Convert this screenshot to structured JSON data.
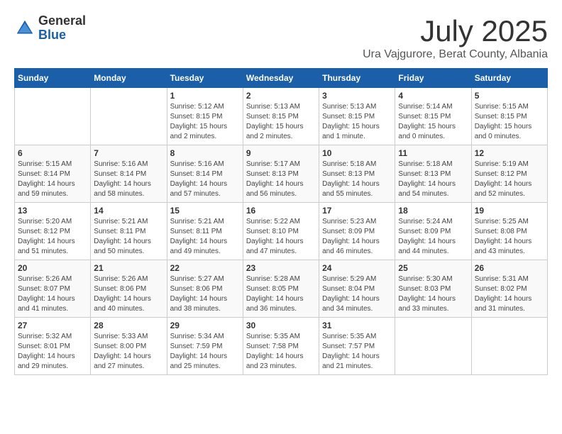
{
  "logo": {
    "general": "General",
    "blue": "Blue"
  },
  "title": {
    "month": "July 2025",
    "location": "Ura Vajgurore, Berat County, Albania"
  },
  "weekdays": [
    "Sunday",
    "Monday",
    "Tuesday",
    "Wednesday",
    "Thursday",
    "Friday",
    "Saturday"
  ],
  "weeks": [
    [
      {
        "day": "",
        "detail": ""
      },
      {
        "day": "",
        "detail": ""
      },
      {
        "day": "1",
        "detail": "Sunrise: 5:12 AM\nSunset: 8:15 PM\nDaylight: 15 hours and 2 minutes."
      },
      {
        "day": "2",
        "detail": "Sunrise: 5:13 AM\nSunset: 8:15 PM\nDaylight: 15 hours and 2 minutes."
      },
      {
        "day": "3",
        "detail": "Sunrise: 5:13 AM\nSunset: 8:15 PM\nDaylight: 15 hours and 1 minute."
      },
      {
        "day": "4",
        "detail": "Sunrise: 5:14 AM\nSunset: 8:15 PM\nDaylight: 15 hours and 0 minutes."
      },
      {
        "day": "5",
        "detail": "Sunrise: 5:15 AM\nSunset: 8:15 PM\nDaylight: 15 hours and 0 minutes."
      }
    ],
    [
      {
        "day": "6",
        "detail": "Sunrise: 5:15 AM\nSunset: 8:14 PM\nDaylight: 14 hours and 59 minutes."
      },
      {
        "day": "7",
        "detail": "Sunrise: 5:16 AM\nSunset: 8:14 PM\nDaylight: 14 hours and 58 minutes."
      },
      {
        "day": "8",
        "detail": "Sunrise: 5:16 AM\nSunset: 8:14 PM\nDaylight: 14 hours and 57 minutes."
      },
      {
        "day": "9",
        "detail": "Sunrise: 5:17 AM\nSunset: 8:13 PM\nDaylight: 14 hours and 56 minutes."
      },
      {
        "day": "10",
        "detail": "Sunrise: 5:18 AM\nSunset: 8:13 PM\nDaylight: 14 hours and 55 minutes."
      },
      {
        "day": "11",
        "detail": "Sunrise: 5:18 AM\nSunset: 8:13 PM\nDaylight: 14 hours and 54 minutes."
      },
      {
        "day": "12",
        "detail": "Sunrise: 5:19 AM\nSunset: 8:12 PM\nDaylight: 14 hours and 52 minutes."
      }
    ],
    [
      {
        "day": "13",
        "detail": "Sunrise: 5:20 AM\nSunset: 8:12 PM\nDaylight: 14 hours and 51 minutes."
      },
      {
        "day": "14",
        "detail": "Sunrise: 5:21 AM\nSunset: 8:11 PM\nDaylight: 14 hours and 50 minutes."
      },
      {
        "day": "15",
        "detail": "Sunrise: 5:21 AM\nSunset: 8:11 PM\nDaylight: 14 hours and 49 minutes."
      },
      {
        "day": "16",
        "detail": "Sunrise: 5:22 AM\nSunset: 8:10 PM\nDaylight: 14 hours and 47 minutes."
      },
      {
        "day": "17",
        "detail": "Sunrise: 5:23 AM\nSunset: 8:09 PM\nDaylight: 14 hours and 46 minutes."
      },
      {
        "day": "18",
        "detail": "Sunrise: 5:24 AM\nSunset: 8:09 PM\nDaylight: 14 hours and 44 minutes."
      },
      {
        "day": "19",
        "detail": "Sunrise: 5:25 AM\nSunset: 8:08 PM\nDaylight: 14 hours and 43 minutes."
      }
    ],
    [
      {
        "day": "20",
        "detail": "Sunrise: 5:26 AM\nSunset: 8:07 PM\nDaylight: 14 hours and 41 minutes."
      },
      {
        "day": "21",
        "detail": "Sunrise: 5:26 AM\nSunset: 8:06 PM\nDaylight: 14 hours and 40 minutes."
      },
      {
        "day": "22",
        "detail": "Sunrise: 5:27 AM\nSunset: 8:06 PM\nDaylight: 14 hours and 38 minutes."
      },
      {
        "day": "23",
        "detail": "Sunrise: 5:28 AM\nSunset: 8:05 PM\nDaylight: 14 hours and 36 minutes."
      },
      {
        "day": "24",
        "detail": "Sunrise: 5:29 AM\nSunset: 8:04 PM\nDaylight: 14 hours and 34 minutes."
      },
      {
        "day": "25",
        "detail": "Sunrise: 5:30 AM\nSunset: 8:03 PM\nDaylight: 14 hours and 33 minutes."
      },
      {
        "day": "26",
        "detail": "Sunrise: 5:31 AM\nSunset: 8:02 PM\nDaylight: 14 hours and 31 minutes."
      }
    ],
    [
      {
        "day": "27",
        "detail": "Sunrise: 5:32 AM\nSunset: 8:01 PM\nDaylight: 14 hours and 29 minutes."
      },
      {
        "day": "28",
        "detail": "Sunrise: 5:33 AM\nSunset: 8:00 PM\nDaylight: 14 hours and 27 minutes."
      },
      {
        "day": "29",
        "detail": "Sunrise: 5:34 AM\nSunset: 7:59 PM\nDaylight: 14 hours and 25 minutes."
      },
      {
        "day": "30",
        "detail": "Sunrise: 5:35 AM\nSunset: 7:58 PM\nDaylight: 14 hours and 23 minutes."
      },
      {
        "day": "31",
        "detail": "Sunrise: 5:35 AM\nSunset: 7:57 PM\nDaylight: 14 hours and 21 minutes."
      },
      {
        "day": "",
        "detail": ""
      },
      {
        "day": "",
        "detail": ""
      }
    ]
  ]
}
